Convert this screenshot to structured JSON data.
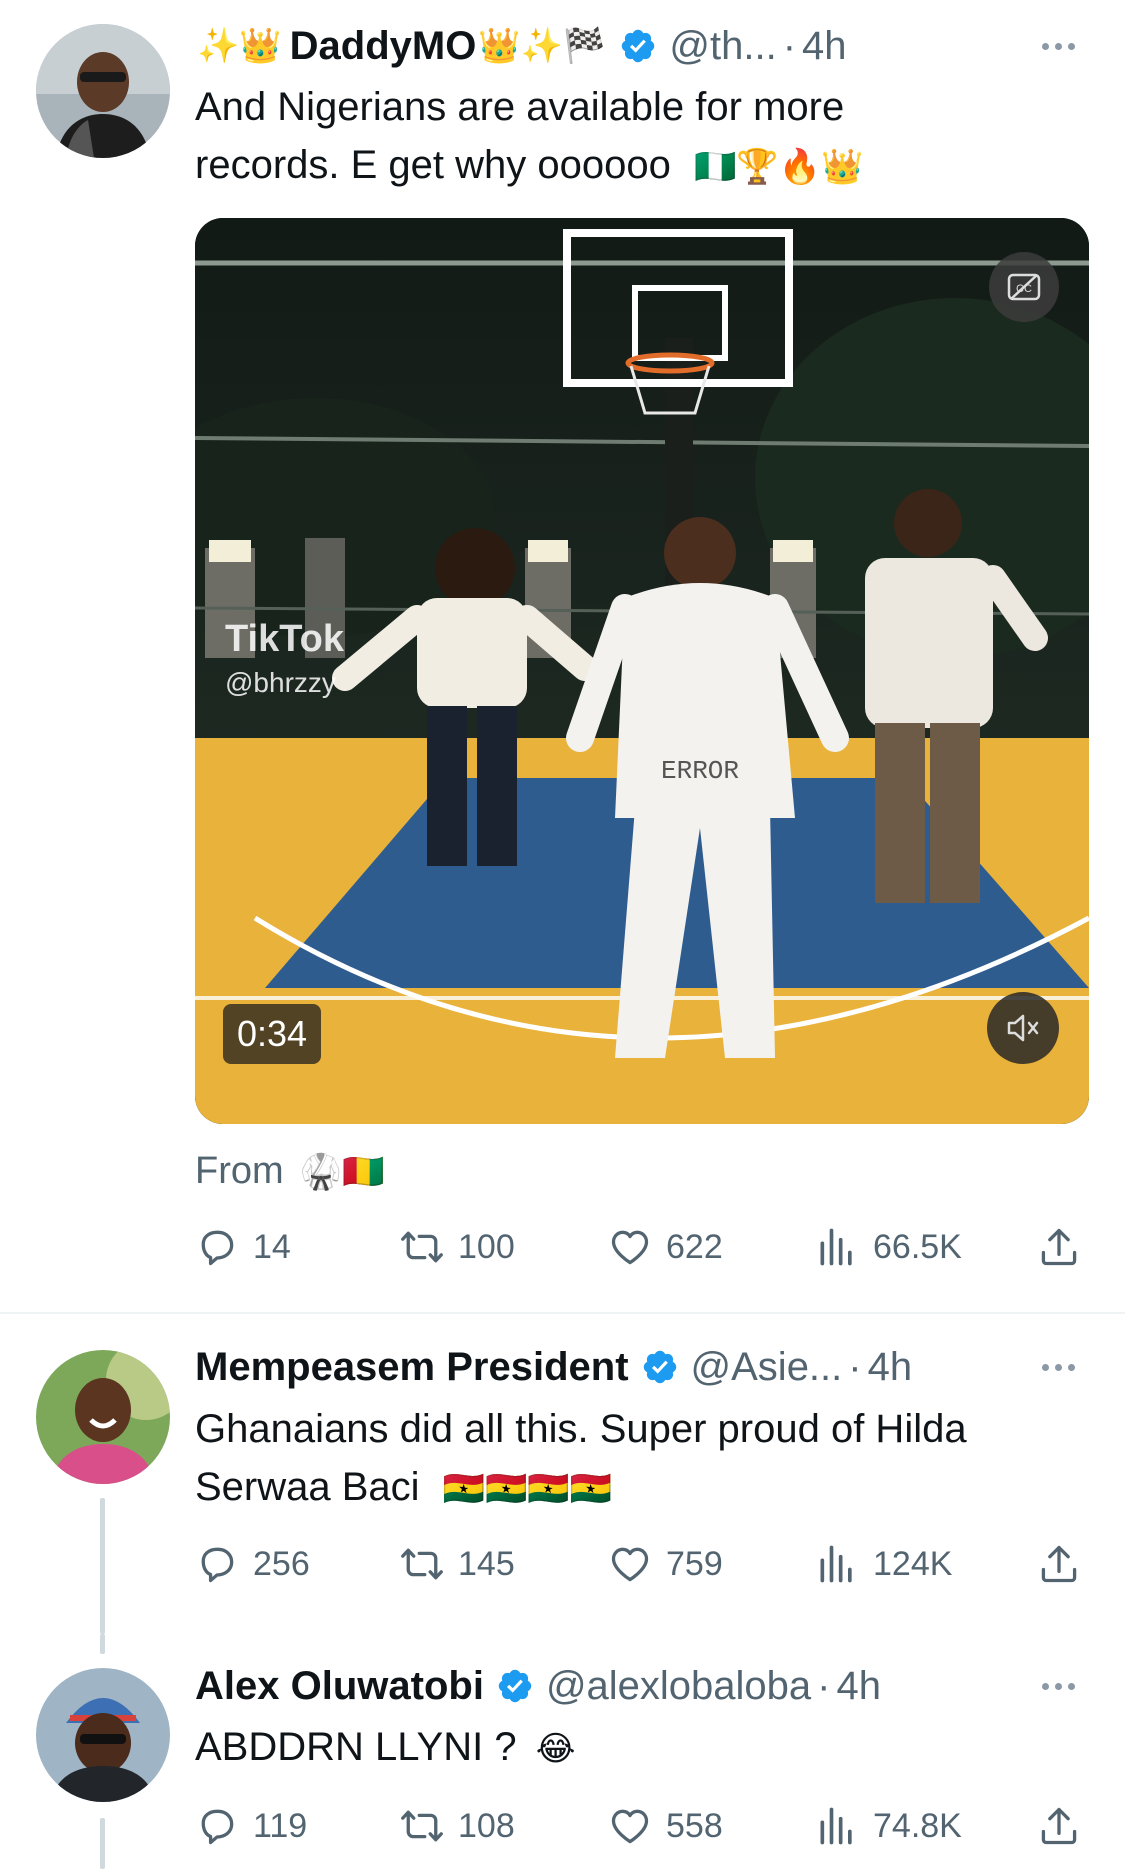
{
  "tweets": [
    {
      "prefix_emojis": "✨👑",
      "name": "DaddyMO",
      "suffix_emojis": "👑✨🏁",
      "handle": "@th...",
      "time": "4h",
      "text_line1": "And Nigerians are available for more",
      "text_line2": "records. E get why oooooo",
      "text_emojis": "🇳🇬🏆🔥👑",
      "media": {
        "duration": "0:34",
        "watermark": "TikTok",
        "watermark_user": "@bhrzzy",
        "shirt_text": "ERROR"
      },
      "source_label": "From",
      "source_emojis": "🥋🇬🇳",
      "stats": {
        "replies": "14",
        "retweets": "100",
        "likes": "622",
        "views": "66.5K"
      }
    },
    {
      "name": "Mempeasem President",
      "handle": "@Asie...",
      "time": "4h",
      "text_line1": "Ghanaians did all this. Super proud of Hilda",
      "text_line2": "Serwaa Baci",
      "text_emojis": "🇬🇭🇬🇭🇬🇭🇬🇭",
      "stats": {
        "replies": "256",
        "retweets": "145",
        "likes": "759",
        "views": "124K"
      }
    },
    {
      "name": "Alex Oluwatobi",
      "handle": "@alexlobaloba",
      "time": "4h",
      "text_line1": "ABDDRN LLYNI ?",
      "text_emojis": "😂",
      "stats": {
        "replies": "119",
        "retweets": "108",
        "likes": "558",
        "views": "74.8K"
      }
    }
  ],
  "separator": "·",
  "colors": {
    "verified": "#1d9bf0",
    "secondary": "#536471",
    "court_yellow": "#e9b23a",
    "court_blue": "#2f5c8f"
  }
}
